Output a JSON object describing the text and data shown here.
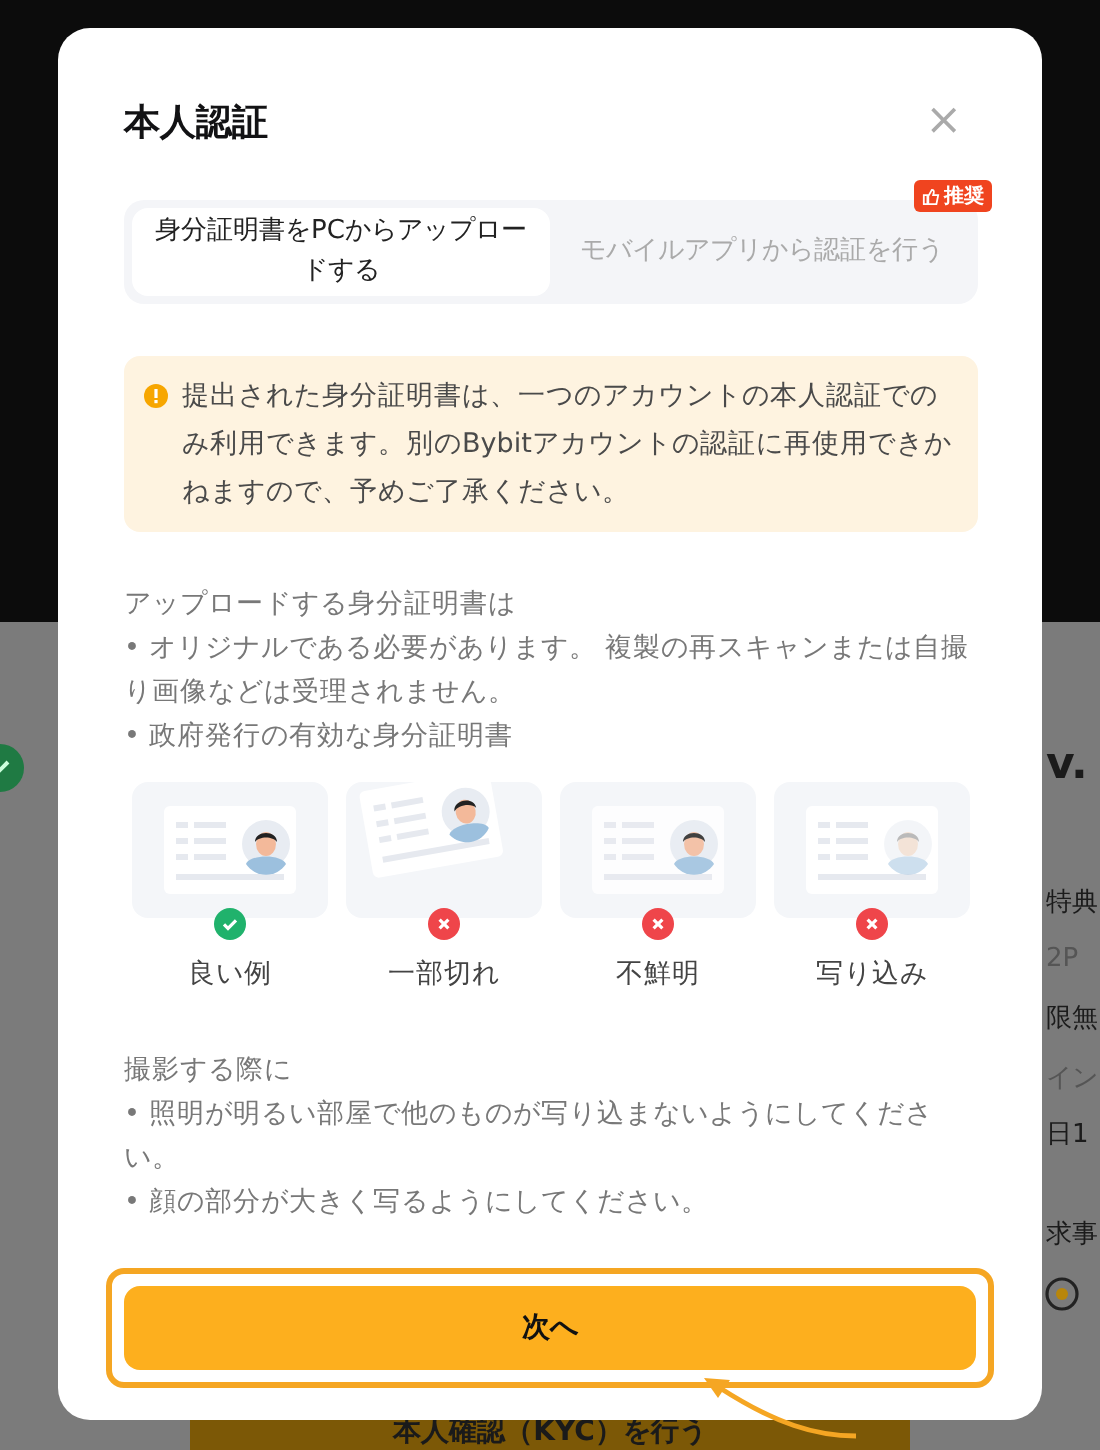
{
  "background": {
    "side_texts": [
      {
        "text": "v.",
        "kind": "heading"
      },
      {
        "text": "特典",
        "kind": "label"
      },
      {
        "text": "2P",
        "kind": "muted"
      },
      {
        "text": "限無",
        "kind": "label"
      },
      {
        "text": "イン",
        "kind": "muted"
      },
      {
        "text": "日1",
        "kind": "label"
      },
      {
        "text": "求事",
        "kind": "label"
      }
    ],
    "button": "本人確認（KYC）を行う"
  },
  "modal": {
    "title": "本人認証",
    "close": "×",
    "tabs": [
      {
        "label": "身分証明書をPCからアップロードする",
        "selected": true
      },
      {
        "label": "モバイルアプリから認証を行う",
        "selected": false,
        "badge": "推奨"
      }
    ],
    "notice": "提出された身分証明書は、一つのアカウントの本人認証でのみ利用できます。別のBybitアカウントの認証に再使用できかねますので、予めご了承ください。",
    "requirements": [
      "アップロードする身分証明書は",
      "• オリジナルである必要があります。 複製の再スキャンまたは自撮り画像などは受理されません。",
      "• 政府発行の有効な身分証明書"
    ],
    "examples": [
      {
        "label": "良い例",
        "ok": true,
        "kind": "good"
      },
      {
        "label": "一部切れ",
        "ok": false,
        "kind": "cropped"
      },
      {
        "label": "不鮮明",
        "ok": false,
        "kind": "blurry"
      },
      {
        "label": "写り込み",
        "ok": false,
        "kind": "glare"
      }
    ],
    "tips": [
      "撮影する際に",
      "• 照明が明るい部屋で他のものが写り込まないようにしてください。",
      "• 顔の部分が大きく写るようにしてください。"
    ],
    "next_button": "次へ"
  }
}
